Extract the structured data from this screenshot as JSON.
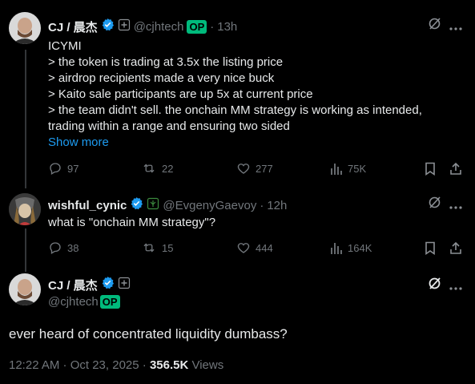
{
  "tweet1": {
    "display_name": "CJ / 晨杰",
    "handle": "@cjhtech",
    "op_badge": "OP",
    "time": "13h",
    "dot": "·",
    "lines": [
      "ICYMI",
      "> the token is trading at 3.5x the listing price",
      "> airdrop recipients made a very nice buck",
      "> Kaito sale participants are up 5x at current price",
      "> the team didn't sell. the onchain MM strategy is working as intended,",
      "trading within a range and ensuring two sided"
    ],
    "show_more": "Show more",
    "replies": "97",
    "reposts": "22",
    "likes": "277",
    "views": "75K"
  },
  "tweet2": {
    "display_name": "wishful_cynic",
    "handle": "@EvgenyGaevoy",
    "time": "12h",
    "dot": "·",
    "text": "what is \"onchain MM strategy\"?",
    "replies": "38",
    "reposts": "15",
    "likes": "444",
    "views": "164K"
  },
  "tweet3": {
    "display_name": "CJ / 晨杰",
    "handle": "@cjhtech",
    "op_badge": "OP",
    "text": "ever heard of concentrated liquidity dumbass?",
    "timestamp": "12:22 AM · Oct 23, 2025 · ",
    "views_count": "356.5K",
    "views_label": " Views"
  },
  "colors": {
    "accent": "#1d9bf0",
    "op_green": "#00ba7c",
    "muted": "#71767b",
    "text": "#e7e9ea"
  },
  "icons": [
    "verified-badge-icon",
    "add-icon",
    "grok-icon",
    "more-icon",
    "reply-icon",
    "repost-icon",
    "like-icon",
    "views-icon",
    "bookmark-icon",
    "share-icon",
    "affiliate-icon"
  ]
}
